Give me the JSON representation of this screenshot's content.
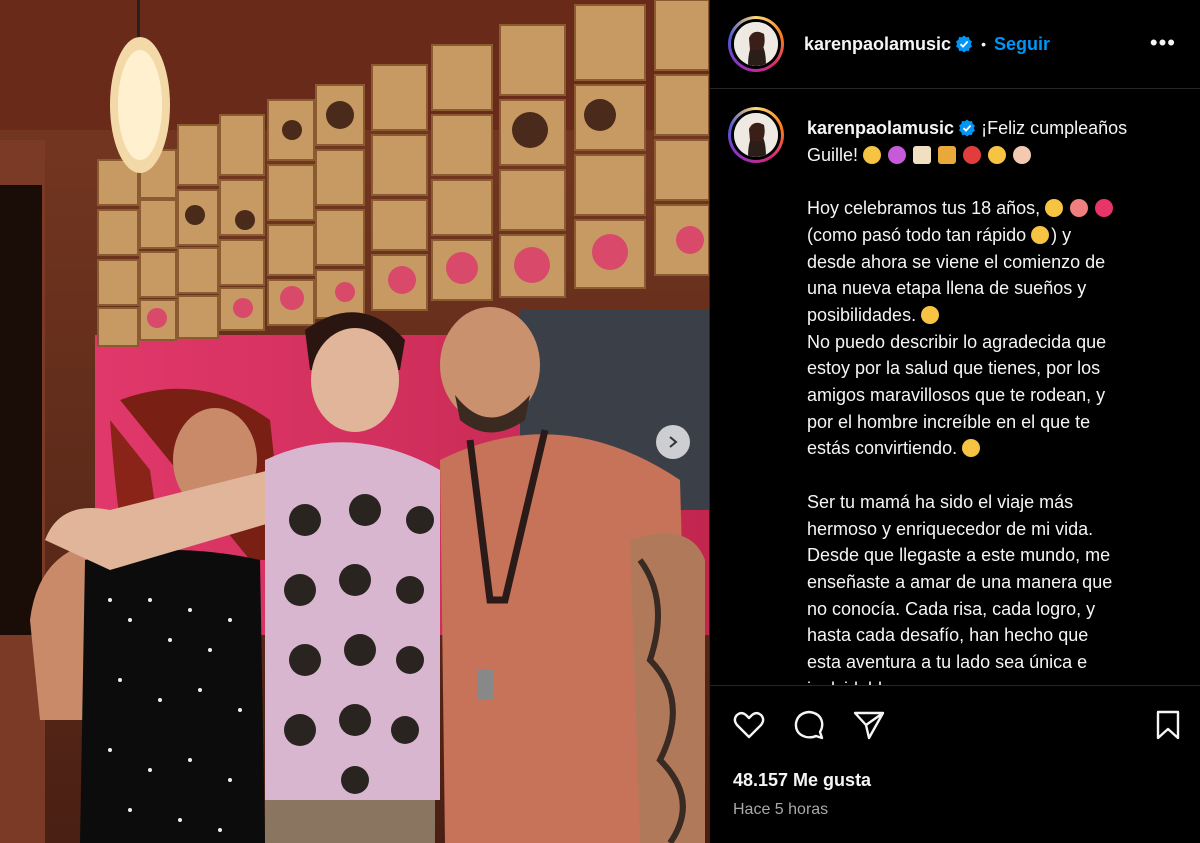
{
  "post": {
    "username": "karenpaolamusic",
    "separator": "•",
    "follow_label": "Seguir",
    "more_label": "•••",
    "caption": {
      "line1_suffix": "¡Feliz cumpleaños",
      "line2": "Guille!",
      "p1_l1": "Hoy celebramos tus 18 años,",
      "p1_l2a": "(como pasó todo tan rápido",
      "p1_l2b": ") y",
      "p1_l3": "desde ahora se viene el comienzo de",
      "p1_l4": "una nueva etapa llena de sueños y",
      "p1_l5": "posibilidades.",
      "p2_l1": "No puedo describir lo agradecida que",
      "p2_l2": "estoy por la salud que tienes, por los",
      "p2_l3": "amigos maravillosos que te rodean, y",
      "p2_l4": "por el hombre increíble en el que te",
      "p2_l5": "estás convirtiendo.",
      "p3_l1": "Ser tu mamá ha sido el viaje más",
      "p3_l2": "hermoso y enriquecedor de mi vida.",
      "p3_l3": "Desde que llegaste a este mundo, me",
      "p3_l4": "enseñaste a amar de una manera que",
      "p3_l5": "no conocía. Cada risa, cada logro, y",
      "p3_l6": "hasta cada desafío, han hecho que",
      "p3_l7": "esta aventura a tu lado sea única e",
      "p3_l8": "inolvidable."
    },
    "likes": "48.157 Me gusta",
    "timestamp": "Hace 5 horas"
  },
  "icons": {
    "verified": "verified-badge-icon",
    "like": "heart-icon",
    "comment": "comment-bubble-icon",
    "share": "paper-plane-icon",
    "save": "bookmark-icon",
    "next": "chevron-right-icon"
  },
  "colors": {
    "accent": "#0095f6",
    "background": "#000000",
    "text": "#f5f5f5",
    "muted": "#a8a8a8"
  }
}
